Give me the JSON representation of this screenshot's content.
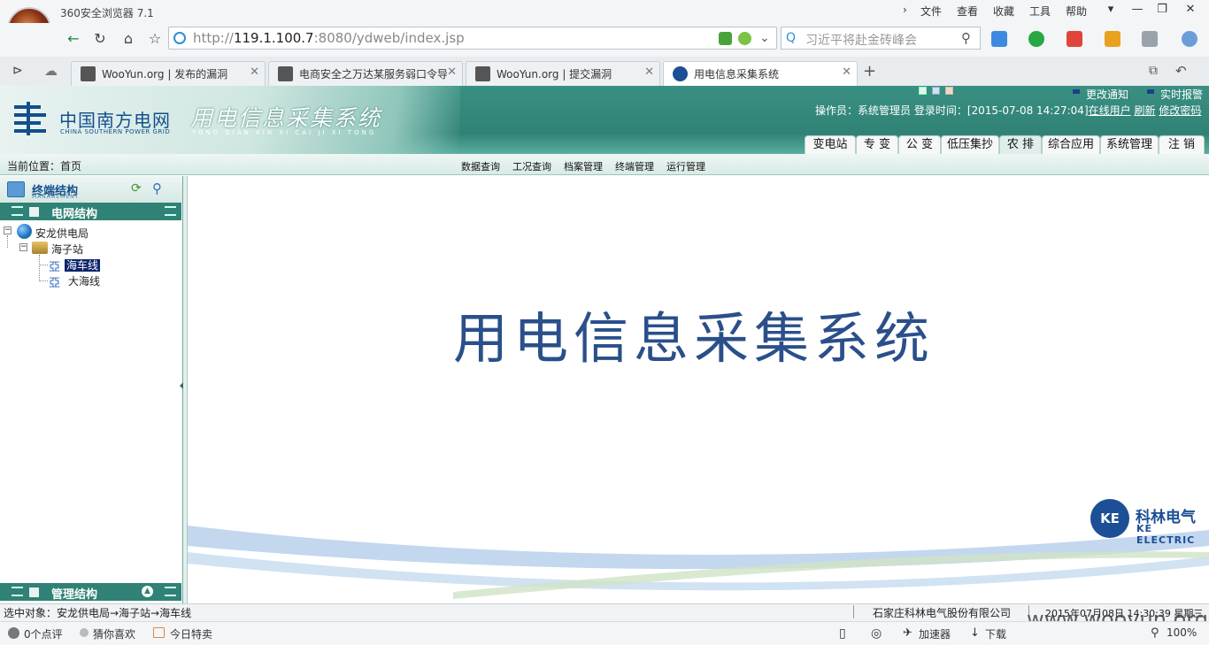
{
  "browser": {
    "app_title": "360安全浏览器 7.1",
    "menus": [
      "文件",
      "查看",
      "收藏",
      "工具",
      "帮助"
    ],
    "url_prefix": "http://",
    "url_host": "119.1.100.7",
    "url_rest": ":8080/ydweb/index.jsp",
    "search_placeholder": "习近平将赴金砖峰会",
    "tabs": [
      {
        "label": "WooYun.org | 发布的漏洞"
      },
      {
        "label": "电商安全之万达某服务弱口令导"
      },
      {
        "label": "WooYun.org | 提交漏洞"
      },
      {
        "label": "用电信息采集系统"
      }
    ],
    "status": {
      "comments": "0个点评",
      "guess": "猜你喜欢",
      "deals": "今日特卖",
      "accelerator": "加速器",
      "download": "下载",
      "zoom": "100%"
    },
    "watermark": "www.wooyun.org"
  },
  "app": {
    "logo_name": "中国南方电网",
    "logo_en": "CHINA SOUTHERN POWER GRID",
    "system_title": "用电信息采集系统",
    "system_pinyin": "YONG DIAN XIN XI CAI JI XI TONG",
    "notice_change": "更改通知",
    "notice_alarm": "实时报警",
    "user_info": "操作员：系统管理员 登录时间：[2015-07-08 14:27:04]",
    "online_users": "在线用户",
    "refresh": "刷新",
    "change_password": "修改密码",
    "module_tabs": [
      "变电站",
      "专 变",
      "公 变",
      "低压集抄",
      "农 排",
      "综合应用",
      "系统管理",
      "注 销"
    ],
    "breadcrumb": "当前位置：首页",
    "submenus": [
      "数据查询",
      "工况查询",
      "档案管理",
      "终端管理",
      "运行管理"
    ],
    "left_panel": {
      "title": "终端结构",
      "subtitle": "MANAGEMENT",
      "grid_section": "电网结构",
      "mgmt_section": "管理结构",
      "tree": {
        "root": "安龙供电局",
        "station": "海子站",
        "lines": [
          "海车线",
          "大海线"
        ]
      }
    },
    "main_title": "用电信息采集系统",
    "vendor_logo": "KE",
    "vendor_cn": "科林电气",
    "vendor_en": "KE ELECTRIC",
    "selected_object": "选中对象：安龙供电局→海子站→海车线",
    "company": "石家庄科林电气股份有限公司",
    "datetime": "2015年07月08日 14:30:39 星期三"
  },
  "colors": {
    "header_teal": "#2f8275",
    "title_blue": "#2a4f8a",
    "selection": "#0a246a"
  }
}
